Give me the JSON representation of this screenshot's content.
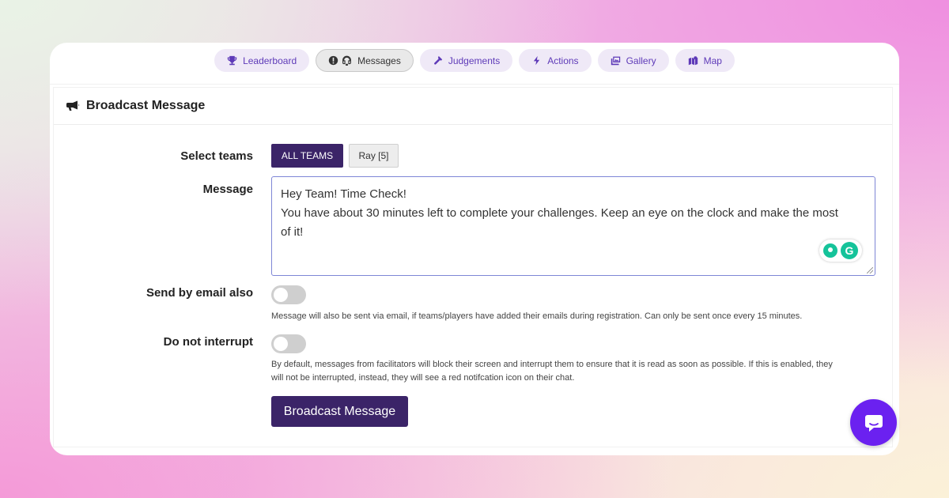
{
  "nav": {
    "tabs": [
      {
        "label": "Leaderboard",
        "icon": "trophy-icon"
      },
      {
        "label": "Messages",
        "icon": "headset-icon",
        "alert_icon": "alert-circle-icon",
        "active": true
      },
      {
        "label": "Judgements",
        "icon": "gavel-icon"
      },
      {
        "label": "Actions",
        "icon": "bolt-icon"
      },
      {
        "label": "Gallery",
        "icon": "images-icon"
      },
      {
        "label": "Map",
        "icon": "map-icon"
      }
    ]
  },
  "panel": {
    "title": "Broadcast Message",
    "icon": "megaphone-icon"
  },
  "form": {
    "select_teams_label": "Select teams",
    "teams": [
      {
        "label": "ALL TEAMS",
        "selected": true
      },
      {
        "label": "Ray [5]",
        "selected": false
      }
    ],
    "message_label": "Message",
    "message_lines": [
      "Hey Team! Time Check!",
      "You have about 30 minutes left to complete your challenges. Keep an eye on the clock and make the most",
      "of it!"
    ],
    "send_email_label": "Send by email also",
    "send_email_on": false,
    "send_email_help": "Message will also be sent via email, if teams/players have added their emails during registration. Can only be sent once every 15 minutes.",
    "no_interrupt_label": "Do not interrupt",
    "no_interrupt_on": false,
    "no_interrupt_help_lines": [
      "By default, messages from facilitators will block their screen and interrupt them to ensure that it is read as soon as possible. If this is enabled, they",
      "will not be interrupted, instead, they will see a red notifcation icon on their chat."
    ],
    "submit_label": "Broadcast Message"
  },
  "colors": {
    "primary": "#3b2468",
    "tab_text": "#5e3ab8",
    "chat_button": "#6b21f0",
    "grammarly": "#15c39a"
  }
}
